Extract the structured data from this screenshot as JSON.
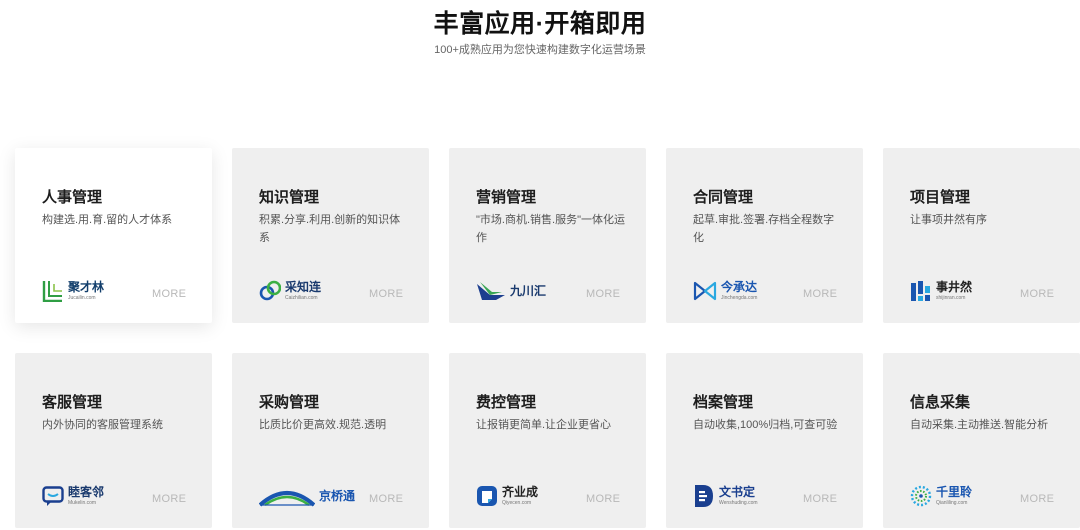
{
  "header": {
    "title": "丰富应用·开箱即用",
    "subtitle": "100+成熟应用为您快速构建数字化运营场景"
  },
  "more_label": "MORE",
  "accent_green": "#2f9e44",
  "accent_blue": "#1a56b0",
  "cards": [
    {
      "title": "人事管理",
      "desc": "构建选.用.育.留的人才体系",
      "logo_name": "聚才林",
      "logo_domain": "Jucailin.com",
      "logo_icon": "bracket-l-icon"
    },
    {
      "title": "知识管理",
      "desc": "积累.分享.利用.创新的知识体系",
      "logo_name": "采知连",
      "logo_domain": "Caizhilian.com",
      "logo_icon": "linked-rings-icon"
    },
    {
      "title": "营销管理",
      "desc": "\"市场.商机.销售.服务\"一体化运作",
      "logo_name": "九川汇",
      "logo_domain": "",
      "logo_icon": "bird-wing-icon"
    },
    {
      "title": "合同管理",
      "desc": "起草.审批.签署.存档全程数字化",
      "logo_name": "今承达",
      "logo_domain": "Jinchengda.com",
      "logo_icon": "bowtie-icon"
    },
    {
      "title": "项目管理",
      "desc": "让事项井然有序",
      "logo_name": "事井然",
      "logo_domain": "shijinran.com",
      "logo_icon": "bar-blocks-icon"
    },
    {
      "title": "客服管理",
      "desc": "内外协同的客服管理系统",
      "logo_name": "睦客邻",
      "logo_domain": "Mukelin.com",
      "logo_icon": "chat-bubble-icon"
    },
    {
      "title": "采购管理",
      "desc": "比质比价更高效.规范.透明",
      "logo_name": "京桥通",
      "logo_domain": "",
      "logo_icon": "bridge-arc-icon"
    },
    {
      "title": "费控管理",
      "desc": "让报销更简单.让企业更省心",
      "logo_name": "齐业成",
      "logo_domain": "Qiyecen.com",
      "logo_icon": "rounded-square-icon"
    },
    {
      "title": "档案管理",
      "desc": "自动收集,100%归档,可查可验",
      "logo_name": "文书定",
      "logo_domain": "Wenshuding.com",
      "logo_icon": "letter-d-icon"
    },
    {
      "title": "信息采集",
      "desc": "自动采集.主动推送.智能分析",
      "logo_name": "千里聆",
      "logo_domain": "Qianliling.com",
      "logo_icon": "dotted-circle-icon"
    }
  ]
}
